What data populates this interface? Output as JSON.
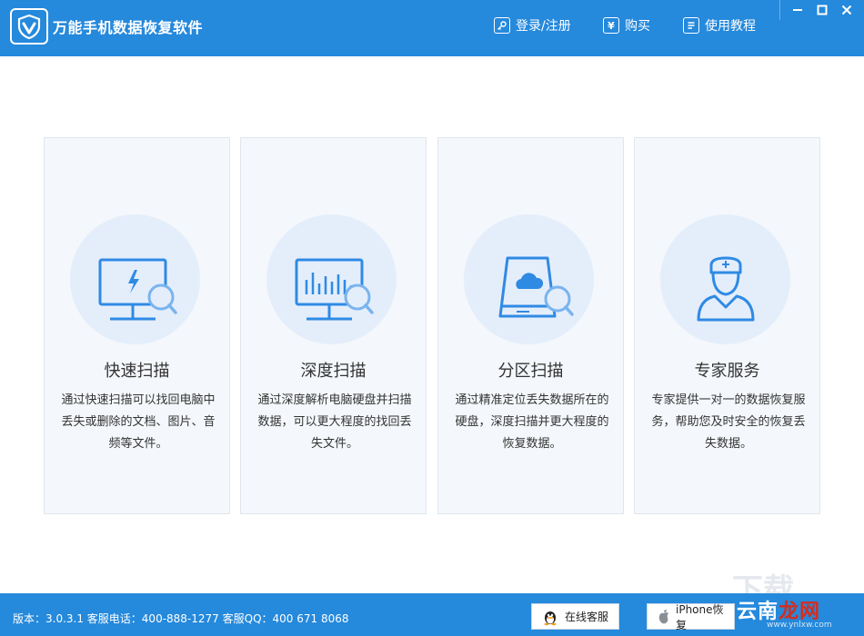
{
  "app": {
    "title": "万能手机数据恢复软件"
  },
  "header": {
    "login_label": "登录/注册",
    "buy_label": "购买",
    "tutorial_label": "使用教程",
    "buy_icon_glyph": "¥"
  },
  "cards": [
    {
      "title": "快速扫描",
      "description": "通过快速扫描可以找回电脑中丢失或删除的文档、图片、音频等文件。",
      "icon": "monitor-lightning-search-icon"
    },
    {
      "title": "深度扫描",
      "description": "通过深度解析电脑硬盘并扫描数据，可以更大程度的找回丢失文件。",
      "icon": "monitor-chart-search-icon"
    },
    {
      "title": "分区扫描",
      "description": "通过精准定位丢失数据所在的硬盘，深度扫描并更大程度的恢复数据。",
      "icon": "disk-cloud-search-icon"
    },
    {
      "title": "专家服务",
      "description": "专家提供一对一的数据恢复服务，帮助您及时安全的恢复丢失数据。",
      "icon": "expert-doctor-icon"
    }
  ],
  "status": {
    "version_info": "版本：3.0.3.1  客服电话：400-888-1277    客服QQ：400 671 8068",
    "online_service_label": "在线客服",
    "iphone_recover_label": "iPhone恢复"
  },
  "watermark": {
    "brand_a": "云南",
    "brand_b": "龙网",
    "domain": "www.ynlxw.com",
    "bg_text": "下载"
  },
  "colors": {
    "primary": "#2589dc",
    "icon_blue": "#2f8ae4",
    "card_bg": "#f4f7fb",
    "circle_bg": "#e4eefb"
  }
}
